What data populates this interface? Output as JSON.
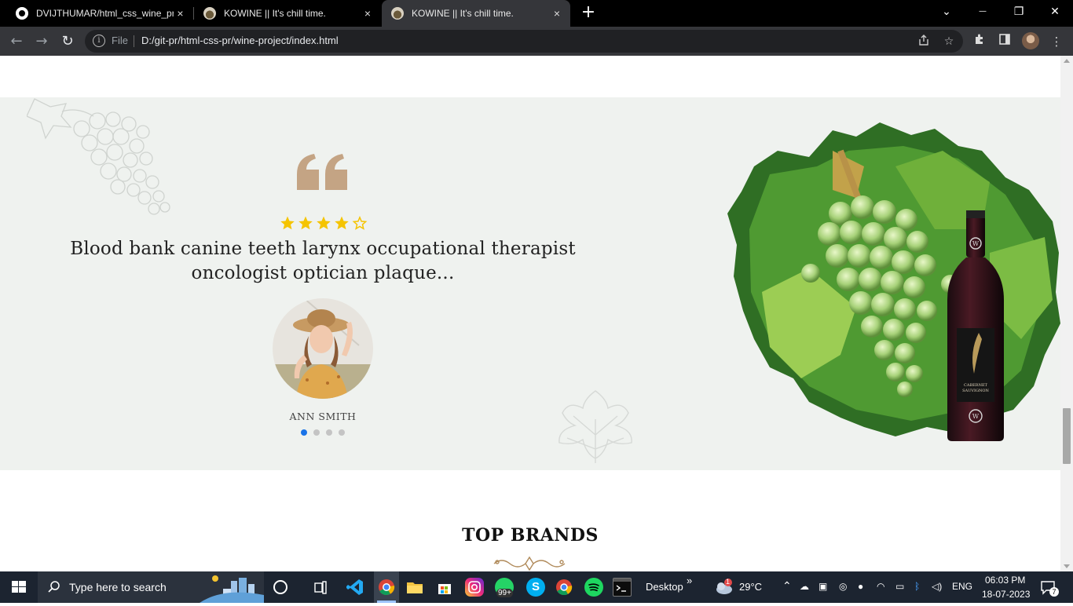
{
  "browser": {
    "tabs": [
      {
        "title": "DVIJTHUMAR/html_css_wine_pro",
        "close": "×"
      },
      {
        "title": "KOWINE || It's chill time.",
        "close": "×"
      },
      {
        "title": "KOWINE || It's chill time.",
        "close": "×",
        "active": true
      }
    ],
    "new_tab": "+",
    "window_buttons": {
      "tab_search": "⌄",
      "minimize": "—",
      "restore": "❐",
      "close": "✕"
    },
    "nav": {
      "back": "←",
      "forward": "→",
      "reload": "↻"
    },
    "omnibox": {
      "info": "i",
      "scheme": "File",
      "url": "D:/git-pr/html-css-pr/wine-project/index.html"
    }
  },
  "testimonial": {
    "rating": 4,
    "rating_max": 5,
    "review": "Blood bank canine teeth larynx occupational therapist oncologist optician plaque...",
    "reviewer": "ANN SMITH",
    "slides": 4,
    "active_slide": 0,
    "colors": {
      "quote": "#c4a484",
      "star": "#f5c400",
      "dot_active": "#1a73e8",
      "section_bg": "#eff2ef"
    }
  },
  "brands": {
    "title": "TOP BRANDS"
  },
  "bottle_label": {
    "line1": "CABERNET",
    "line2": "SAUVIGNON",
    "monogram": "W"
  },
  "taskbar": {
    "search_placeholder": "Type here to search",
    "desktop_label": "Desktop",
    "overflow": "»",
    "weather": "29°C",
    "weather_badge": "1",
    "whatsapp_badge": "99+",
    "language": "ENG",
    "time": "06:03 PM",
    "date": "18-07-2023",
    "notifications": "7"
  }
}
